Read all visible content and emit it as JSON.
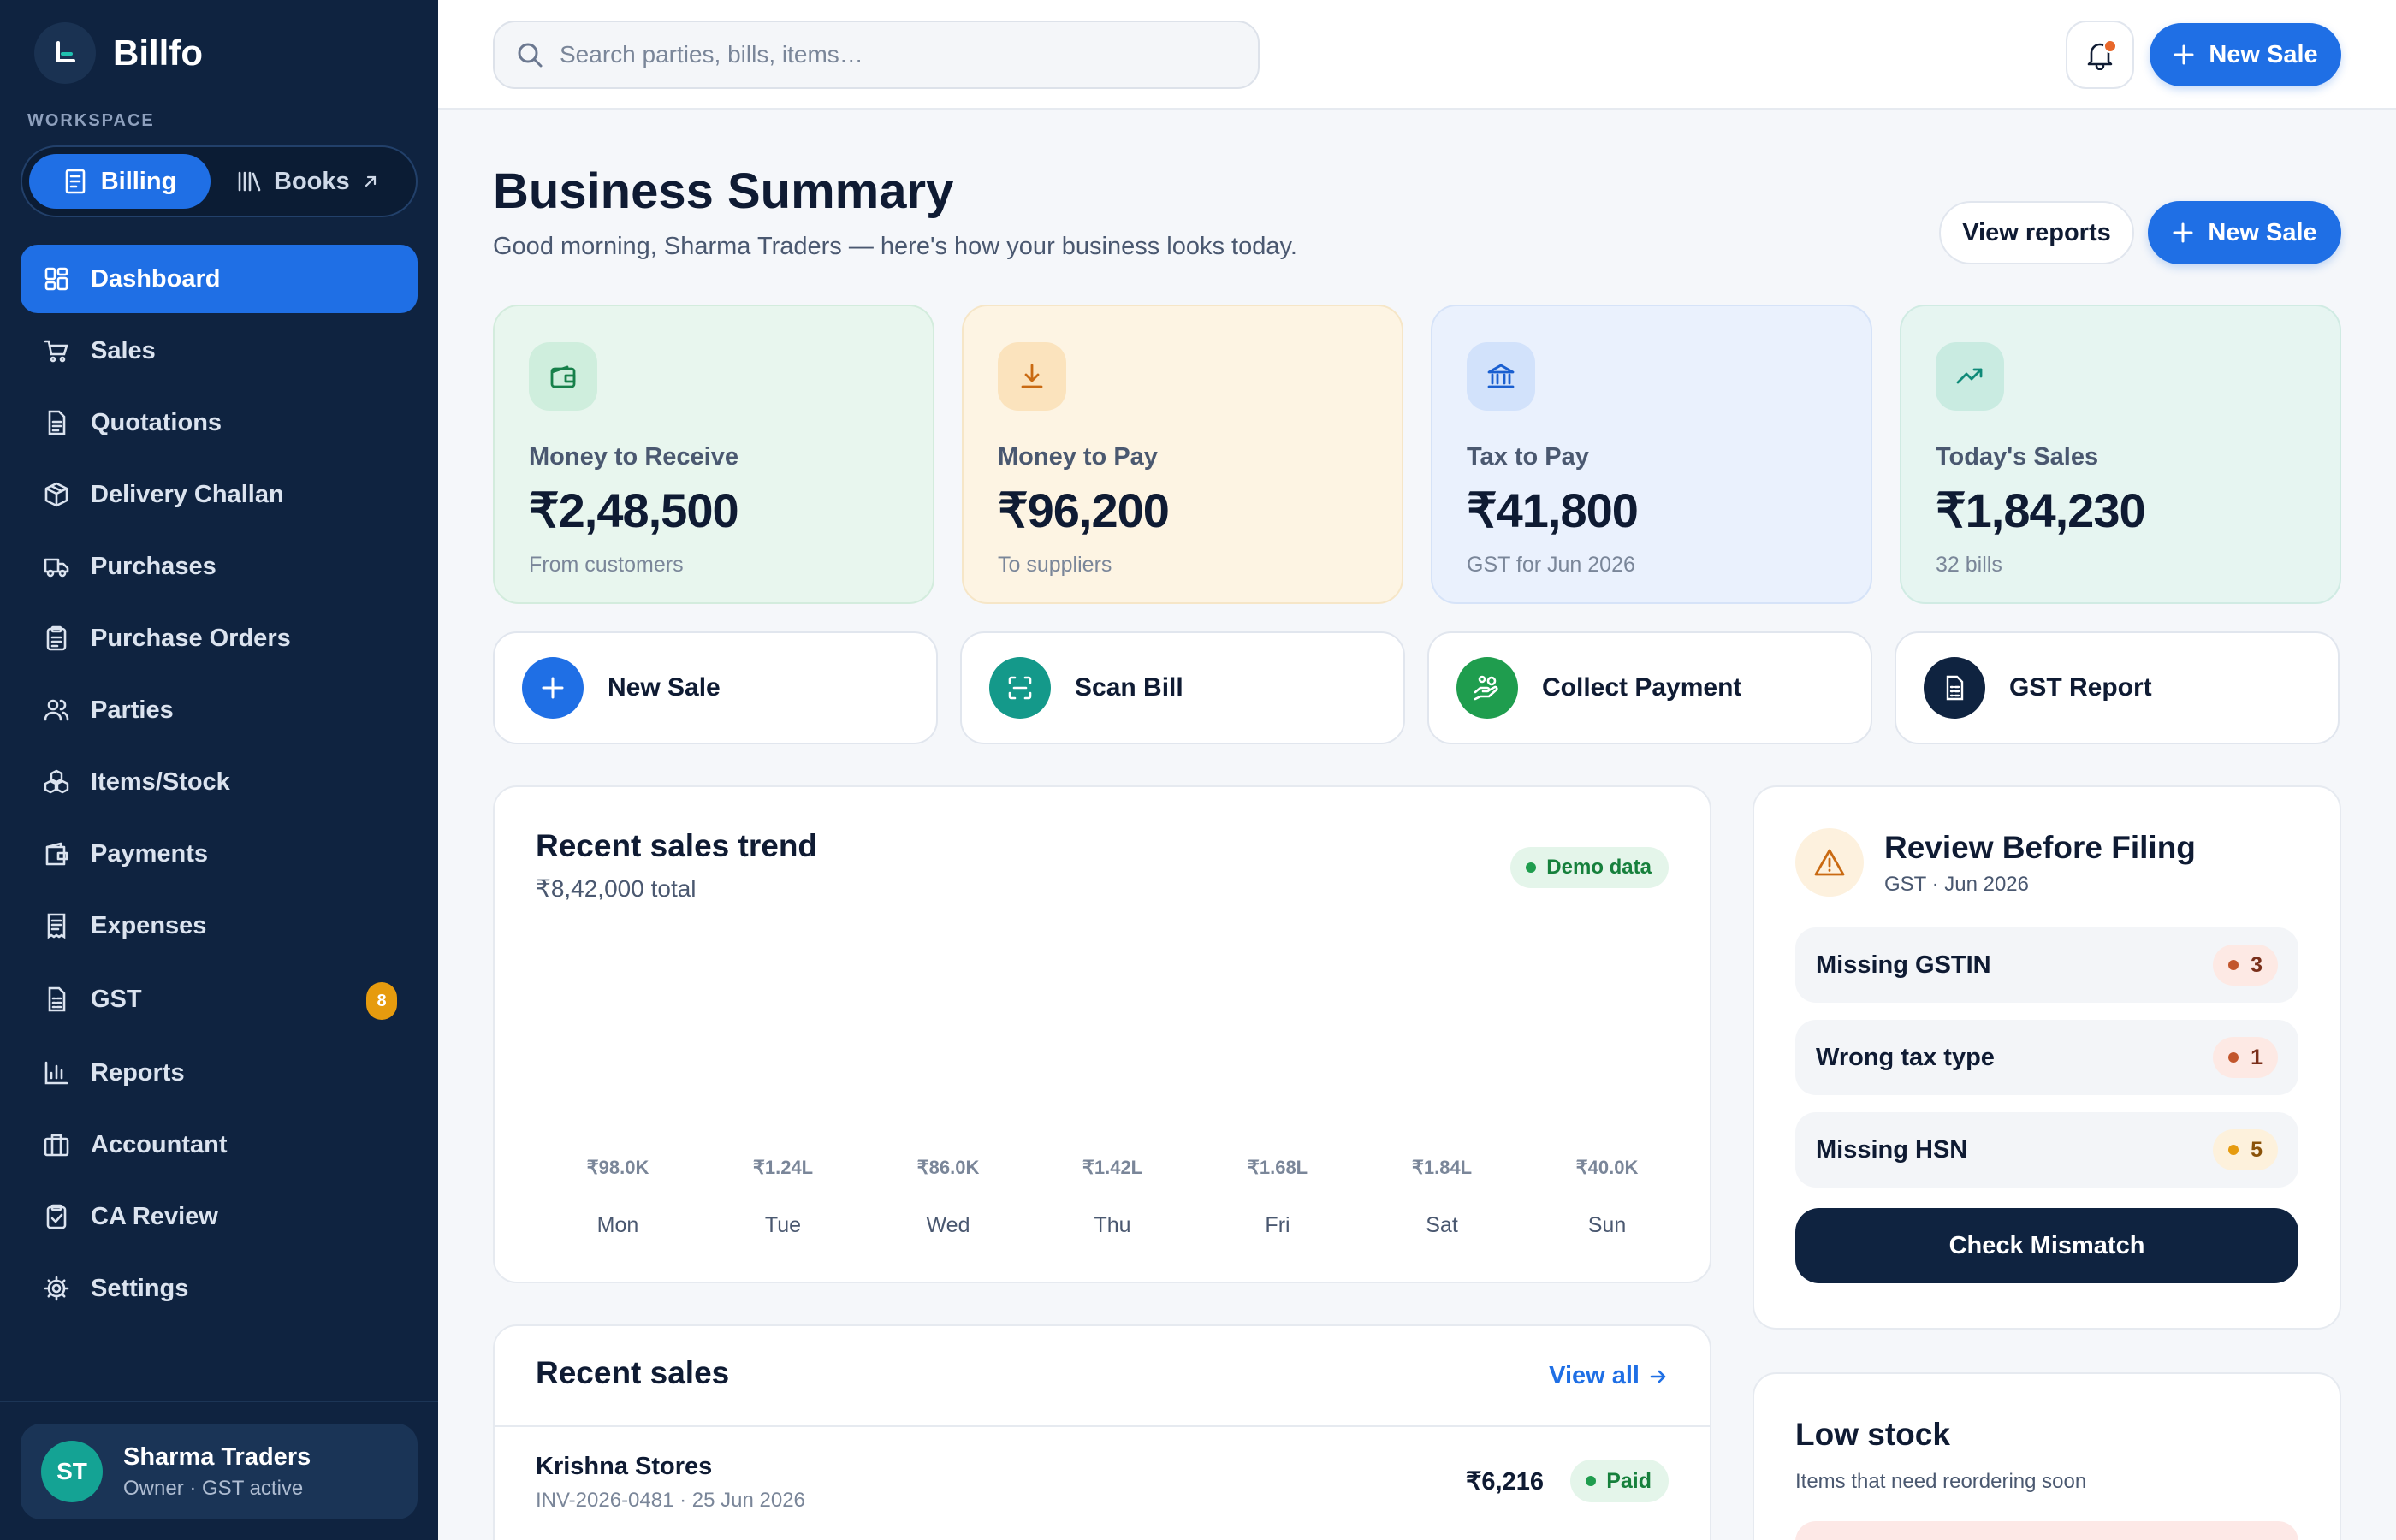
{
  "app": {
    "name": "Billfo"
  },
  "workspace": {
    "label": "WORKSPACE",
    "billing": "Billing",
    "books": "Books"
  },
  "nav": [
    {
      "label": "Dashboard",
      "icon": "dashboard-icon"
    },
    {
      "label": "Sales",
      "icon": "cart-icon"
    },
    {
      "label": "Quotations",
      "icon": "document-icon"
    },
    {
      "label": "Delivery Challan",
      "icon": "package-icon"
    },
    {
      "label": "Purchases",
      "icon": "truck-icon"
    },
    {
      "label": "Purchase Orders",
      "icon": "clipboard-icon"
    },
    {
      "label": "Parties",
      "icon": "users-icon"
    },
    {
      "label": "Items/Stock",
      "icon": "boxes-icon"
    },
    {
      "label": "Payments",
      "icon": "wallet-icon"
    },
    {
      "label": "Expenses",
      "icon": "receipt-icon"
    },
    {
      "label": "GST",
      "icon": "tax-document-icon",
      "badge": "8"
    },
    {
      "label": "Reports",
      "icon": "bar-chart-icon"
    },
    {
      "label": "Accountant",
      "icon": "briefcase-icon"
    },
    {
      "label": "CA Review",
      "icon": "clipboard-check-icon"
    },
    {
      "label": "Settings",
      "icon": "gear-icon"
    }
  ],
  "user": {
    "initials": "ST",
    "name": "Sharma Traders",
    "subtitle": "Owner · GST active"
  },
  "search": {
    "placeholder": "Search parties, bills, items…"
  },
  "topbar": {
    "new_sale": "New Sale"
  },
  "header": {
    "title": "Business Summary",
    "subtitle": "Good morning, Sharma Traders — here's how your business looks today.",
    "view_reports": "View reports",
    "new_sale": "New Sale"
  },
  "stats": [
    {
      "label": "Money to Receive",
      "value": "₹2,48,500",
      "sub": "From customers",
      "icon": "wallet-icon"
    },
    {
      "label": "Money to Pay",
      "value": "₹96,200",
      "sub": "To suppliers",
      "icon": "download-icon"
    },
    {
      "label": "Tax to Pay",
      "value": "₹41,800",
      "sub": "GST for Jun 2026",
      "icon": "bank-icon"
    },
    {
      "label": "Today's Sales",
      "value": "₹1,84,230",
      "sub": "32 bills",
      "icon": "trending-up-icon"
    }
  ],
  "quick_actions": [
    {
      "label": "New Sale",
      "icon": "plus-icon"
    },
    {
      "label": "Scan Bill",
      "icon": "scan-icon"
    },
    {
      "label": "Collect Payment",
      "icon": "hand-coins-icon"
    },
    {
      "label": "GST Report",
      "icon": "report-icon"
    }
  ],
  "trend": {
    "title": "Recent sales trend",
    "total": "₹8,42,000 total",
    "badge": "Demo data",
    "bars": [
      {
        "day": "Mon",
        "label": "₹98.0K"
      },
      {
        "day": "Tue",
        "label": "₹1.24L"
      },
      {
        "day": "Wed",
        "label": "₹86.0K"
      },
      {
        "day": "Thu",
        "label": "₹1.42L"
      },
      {
        "day": "Fri",
        "label": "₹1.68L"
      },
      {
        "day": "Sat",
        "label": "₹1.84L"
      },
      {
        "day": "Sun",
        "label": "₹40.0K"
      }
    ]
  },
  "review": {
    "title": "Review Before Filing",
    "subtitle": "GST · Jun 2026",
    "issues": [
      {
        "label": "Missing GSTIN",
        "count": "3"
      },
      {
        "label": "Wrong tax type",
        "count": "1"
      },
      {
        "label": "Missing HSN",
        "count": "5"
      }
    ],
    "button": "Check Mismatch"
  },
  "recent_sales": {
    "title": "Recent sales",
    "view_all": "View all",
    "rows": [
      {
        "name": "Krishna Stores",
        "meta": "INV-2026-0481 · 25 Jun 2026",
        "amount": "₹6,216",
        "status": "Paid"
      }
    ]
  },
  "low_stock": {
    "title": "Low stock",
    "subtitle": "Items that need reordering soon"
  },
  "colors": {
    "accent": "#1f6fe5",
    "sidebar": "#0f2340",
    "success": "#16803c",
    "warning": "#e69b0e"
  }
}
